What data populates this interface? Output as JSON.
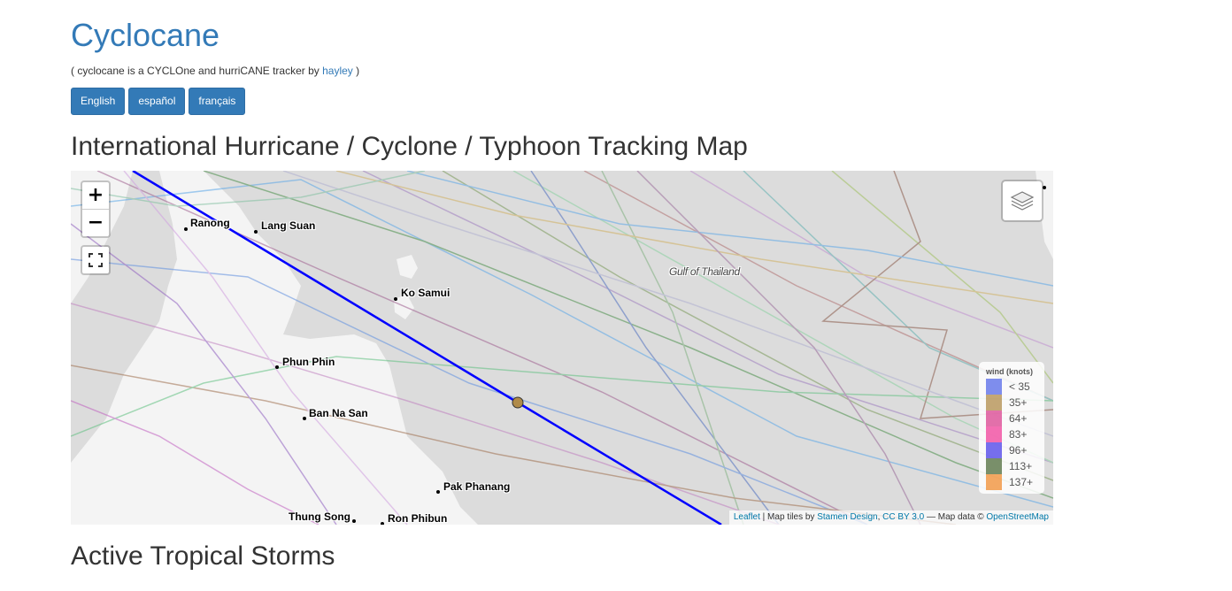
{
  "header": {
    "title": "Cyclocane",
    "tagline_prefix": "( cyclocane is a CYCLOne and hurriCANE tracker by ",
    "tagline_link": "hayley",
    "tagline_suffix": " )"
  },
  "languages": [
    "English",
    "español",
    "français"
  ],
  "sections": {
    "map_heading": "International Hurricane / Cyclone / Typhoon Tracking Map",
    "storms_heading": "Active Tropical Storms"
  },
  "map": {
    "zoom_in": "+",
    "zoom_out": "−",
    "sea_label": "Gulf of Thailand",
    "places": [
      "Ranong",
      "Lang Suan",
      "Ko Samui",
      "Phun Phin",
      "Ban Na San",
      "Pak Phanang",
      "Thung Song",
      "Ron Phibun"
    ],
    "legend": {
      "title": "wind (knots)",
      "items": [
        {
          "label": "< 35",
          "color": "#5468e8"
        },
        {
          "label": "35+",
          "color": "#b08b4a"
        },
        {
          "label": "64+",
          "color": "#d9428f"
        },
        {
          "label": "83+",
          "color": "#f03f9a"
        },
        {
          "label": "96+",
          "color": "#4a3fe8"
        },
        {
          "label": "113+",
          "color": "#4d6b3a"
        },
        {
          "label": "137+",
          "color": "#f08c30"
        }
      ]
    },
    "attribution": {
      "leaflet": "Leaflet",
      "tiles_text": " | Map tiles by ",
      "stamen": "Stamen Design",
      "sep": ", ",
      "license": "CC BY 3.0",
      "data_text": " — Map data © ",
      "osm": "OpenStreetMap"
    },
    "colors": {
      "active_track": "#0000ff",
      "storm_marker": "#b08b4a"
    }
  }
}
